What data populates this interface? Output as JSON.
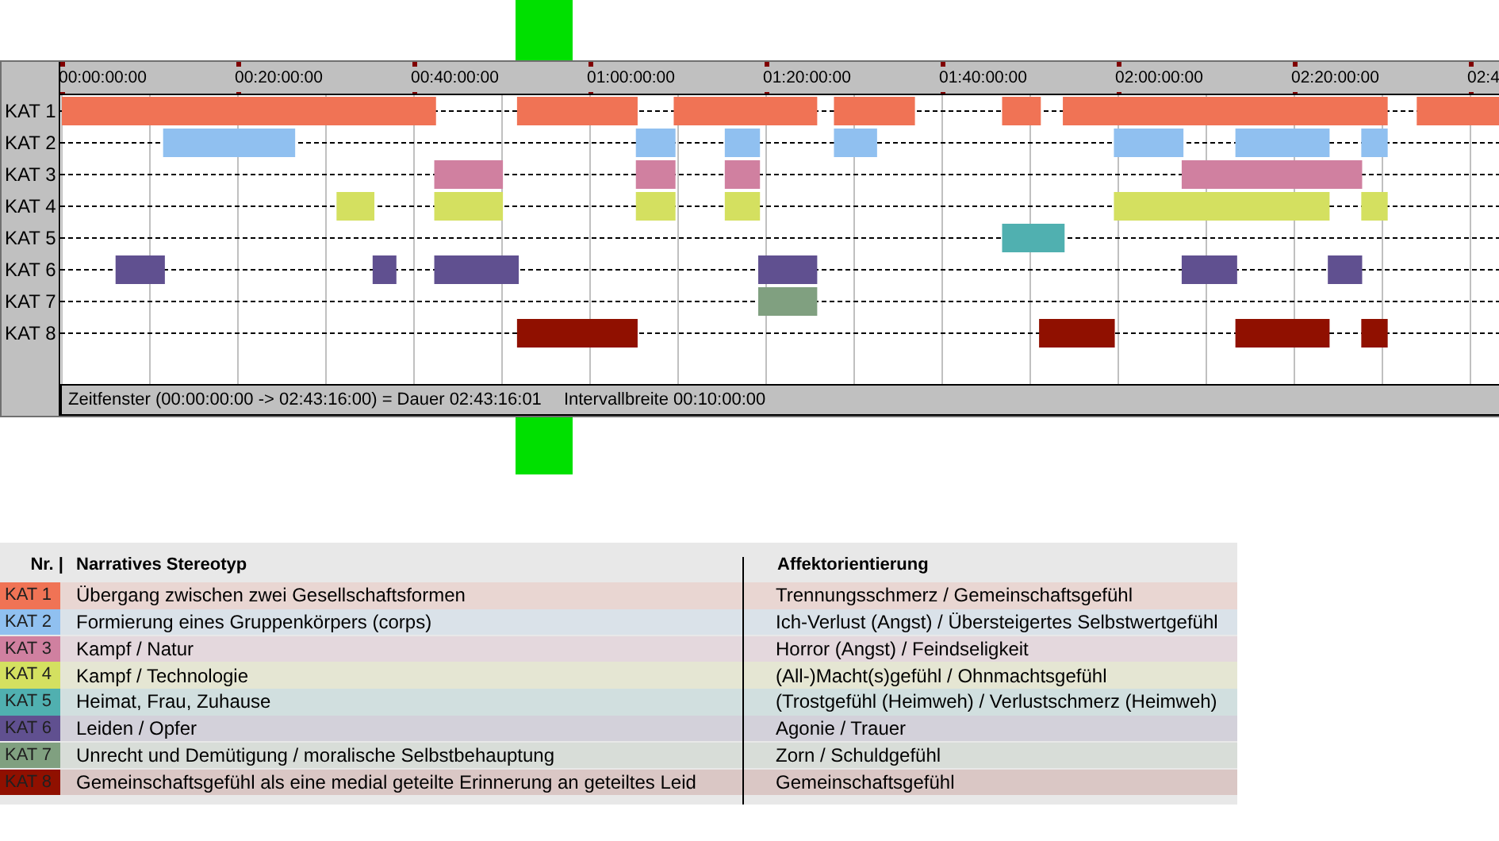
{
  "timeline": {
    "ticks": [
      "00:00:00:00",
      "00:20:00:00",
      "00:40:00:00",
      "01:00:00:00",
      "01:20:00:00",
      "01:40:00:00",
      "02:00:00:00",
      "02:20:00:00",
      "02:4"
    ],
    "row_labels": [
      "KAT 1",
      "KAT 2",
      "KAT 3",
      "KAT 4",
      "KAT 5",
      "KAT 6",
      "KAT 7",
      "KAT 8"
    ],
    "status_bar": {
      "window": "Zeitfenster (00:00:00:00 -> 02:43:16:00) = Dauer 02:43:16:01",
      "interval": "Intervallbreite 00:10:00:00"
    }
  },
  "legend": {
    "columns": [
      "Nr. |",
      "Narratives Stereotyp",
      "Affektorientierung"
    ],
    "rows": [
      {
        "category": "KAT 1",
        "color": "#f07355",
        "stereotype": "Übergang zwischen zwei Gesellschaftsformen",
        "affect": "Trennungsschmerz / Gemeinschaftsgefühl"
      },
      {
        "category": "KAT 2",
        "color": "#90c0f0",
        "stereotype": "Formierung eines Gruppenkörpers (corps)",
        "affect": "Ich-Verlust (Angst) / Übersteigertes Selbstwertgefühl"
      },
      {
        "category": "KAT 3",
        "color": "#d080a0",
        "stereotype": "Kampf / Natur",
        "affect": "Horror (Angst) / Feindseligkeit"
      },
      {
        "category": "KAT 4",
        "color": "#d4e060",
        "stereotype": "Kampf / Technologie",
        "affect": "(All-)Macht(s)gefühl / Ohnmachtsgefühl"
      },
      {
        "category": "KAT 5",
        "color": "#50b0b0",
        "stereotype": "Heimat, Frau, Zuhause",
        "affect": "(Trostgefühl (Heimweh) / Verlustschmerz (Heimweh)"
      },
      {
        "category": "KAT 6",
        "color": "#605090",
        "stereotype": "Leiden / Opfer",
        "affect": "Agonie / Trauer"
      },
      {
        "category": "KAT 7",
        "color": "#80a080",
        "stereotype": "Unrecht und Demütigung / moralische Selbstbehauptung",
        "affect": "Zorn / Schuldgefühl"
      },
      {
        "category": "KAT 8",
        "color": "#901000",
        "stereotype": "Gemeinschaftsgefühl als eine medial geteilte Erinnerung an geteiltes Leid",
        "affect": "Gemeinschaftsgefühl"
      }
    ]
  }
}
